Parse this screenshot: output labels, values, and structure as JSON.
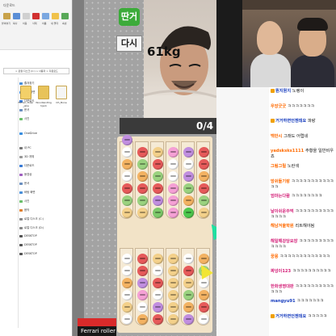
{
  "explorer": {
    "address": "> 로컬 디스크 (C:) > 사용자 > 다운로드",
    "ribbon_labels": [
      "붙여넣기",
      "복사",
      "이동",
      "삭제",
      "이름",
      "새 폴더",
      "속성"
    ],
    "tree_items": [
      "즐겨찾기",
      "바탕 화면",
      "다운로드",
      "문서",
      "사진",
      "OneDrive",
      "내 PC",
      "3D 개체",
      "다운로드",
      "동영상",
      "문서",
      "바탕 화면",
      "사진",
      "음악",
      "로컬 디스크 (C:)",
      "로컬 디스크 (D:)",
      "DESKTOP",
      "DESKTOP",
      "DESKTOP"
    ],
    "files": [
      {
        "name": "Ferrari_roller_jake",
        "icon_color": "#f3d068"
      },
      {
        "name": "Woodlandhighjack",
        "icon_color": "#e8c35a"
      },
      {
        "name": "Oh_Bone",
        "icon_color": "#f5f5f5"
      }
    ],
    "window_title": "다운로드"
  },
  "game": {
    "logo": "딴거",
    "retry": "다시",
    "weight": "61kg",
    "progress": "0/4",
    "tubes": [
      [
        "#f3d08a",
        "#9ad27f",
        "#e65a5a",
        "#ffffff",
        "#f3b262",
        "#ffffff",
        "#c18ee0"
      ],
      [
        "#f3d08a",
        "#9ad27f",
        "#e65a5a",
        "#f3b262",
        "#9ad27f",
        "#e65a5a"
      ],
      [
        "#7ec96a",
        "#c18ee0",
        "#e65a5a",
        "#9ad27f",
        "#e65a5a",
        "#f3d08a"
      ],
      [
        "#f5a0d5",
        "#f5a0d5",
        "#f5a0d5",
        "#ffffff",
        "#ffffff",
        "#f5a0d5"
      ],
      [
        "#4ec84e",
        "#f3b262",
        "#9ad27f",
        "#c18ee0",
        "#ffffff",
        "#c18ee0"
      ],
      [
        "#f3d08a",
        "#9ad27f",
        "#e65a5a",
        "#f3b262",
        "#e65a5a",
        "#e65a5a"
      ],
      [
        "#ffffff",
        "#f3d08a",
        "#ffffff",
        "#f3b262",
        "#ffffff",
        "#ffffff"
      ],
      [
        "#f3b262",
        "#ffffff",
        "#f5a0d5",
        "#c18ee0",
        "#e65a5a",
        "#e65a5a"
      ],
      [
        "#e65a5a",
        "#c18ee0",
        "#ffffff",
        "#e65a5a",
        "#ffffff",
        "#f3d08a"
      ],
      [
        "#f3d08a",
        "#f3d08a",
        "#f3d08a",
        "#f3d08a",
        "#f3d08a",
        "#f3d08a"
      ],
      [
        "#c18ee0",
        "#f3b262",
        "#9ad27f",
        "#f3d08a",
        "#e65a5a",
        "#ffffff"
      ],
      [
        "#ffffff",
        "#e65a5a",
        "#f3b262",
        "#ffffff",
        "#9ad27f",
        "#f3b262"
      ]
    ],
    "caption": "Ferrari roller"
  },
  "chat": {
    "messages": [
      {
        "name": "뭔지뭔지",
        "msg": "노랭이",
        "color": "#1a3fbf",
        "badge": "#f0a000"
      },
      {
        "name": "우앙굿굿",
        "msg": "ㅋㅋㅋㅋㅋㅋㅋ",
        "color": "#ff6a00",
        "badge": ""
      },
      {
        "name": "거거하면언젠데요",
        "msg": "파랑",
        "color": "#1a3fbf",
        "badge": "#f0a000"
      },
      {
        "name": "백만시",
        "msg": "그래도 어렵네",
        "color": "#ff6a00",
        "badge": ""
      },
      {
        "name": "yadsksks1111",
        "msg": "주황을 일반비우죠",
        "color": "#ff6a00",
        "badge": ""
      },
      {
        "name": "그림그릴",
        "msg": "노란색",
        "color": "#ff6a00",
        "badge": ""
      },
      {
        "name": "망쉬돌기랑",
        "msg": "ㅋㅋㅋㅋㅋㅋㅋㅋㅋㅋㅋㅋㅋ",
        "color": "#ff6a00",
        "badge": ""
      },
      {
        "name": "엄마는다람",
        "msg": "ㅋㅋㅋㅋㅋㅋㅋㅋ",
        "color": "#d4237a",
        "badge": ""
      },
      {
        "name": "날이쉬운주먹",
        "msg": "ㅋㅋㅋㅋㅋㅋㅋㅋㅋㅋㅋㅋㅋㅋ",
        "color": "#d4237a",
        "badge": ""
      },
      {
        "name": "해남겨울학원",
        "msg": "리트해야됨",
        "color": "#ff6a00",
        "badge": ""
      },
      {
        "name": "해일해강당요장",
        "msg": "ㅋㅋㅋㅋㅋㅋㅋㅋㅋㅋㅋㅋㅋ",
        "color": "#d4237a",
        "badge": ""
      },
      {
        "name": "꿍몽",
        "msg": "ㅋㅋㅋㅋㅋㅋㅋㅋㅋㅋㅋㅋㅋ",
        "color": "#ff6a00",
        "badge": ""
      },
      {
        "name": "짜넝이123",
        "msg": "ㅋㅋㅋㅋㅋㅋㅋㅋㅋㅋ",
        "color": "#d4237a",
        "badge": ""
      },
      {
        "name": "한화생명대판",
        "msg": "ㅋㅋㅋㅋㅋㅋㅋㅋㅋㅋㅋㅋㅋ",
        "color": "#d4237a",
        "badge": ""
      },
      {
        "name": "mangyu91",
        "msg": "ㅋㅋㅋㅋㅋㅋㅋ",
        "color": "#1a3fbf",
        "badge": ""
      },
      {
        "name": "거거하면언젠데요",
        "msg": "ㅋㅋㅋㅋㅋ",
        "color": "#1a3fbf",
        "badge": "#f0a000"
      }
    ]
  }
}
